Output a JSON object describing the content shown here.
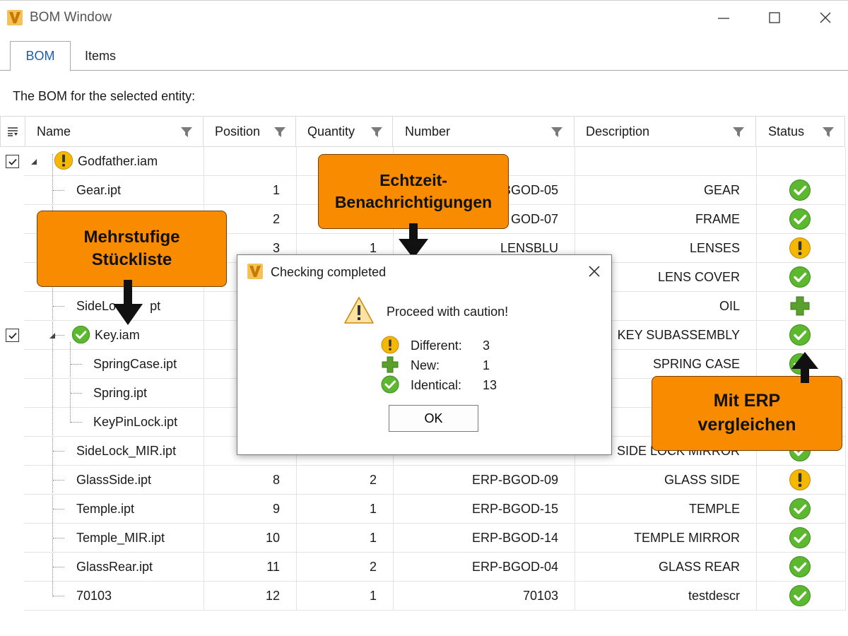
{
  "window": {
    "title": "BOM Window",
    "logo_letter": "V"
  },
  "tabs": [
    {
      "label": "BOM",
      "active": true
    },
    {
      "label": "Items",
      "active": false
    }
  ],
  "caption": "The BOM for the selected entity:",
  "grid": {
    "columns": [
      "Name",
      "Position",
      "Quantity",
      "Number",
      "Description",
      "Status"
    ],
    "rows": [
      {
        "name": "Godfather.iam",
        "position": "",
        "quantity": "",
        "number": "",
        "description": "",
        "status": "",
        "level": 0,
        "checked": true,
        "node_status": "different"
      },
      {
        "name": "Gear.ipt",
        "position": "1",
        "quantity": "",
        "number": "BGOD-05",
        "description": "GEAR",
        "status": "identical",
        "level": 1
      },
      {
        "name": "",
        "position": "2",
        "quantity": "",
        "number": "GOD-07",
        "description": "FRAME",
        "status": "identical",
        "level": 1
      },
      {
        "name": "",
        "position": "3",
        "quantity": "1",
        "number": "LENSBLU",
        "description": "LENSES",
        "status": "different",
        "level": 1
      },
      {
        "name": "",
        "position": "",
        "quantity": "",
        "number": "",
        "description": "LENS COVER",
        "status": "identical",
        "level": 1
      },
      {
        "name": "SideLo",
        "name_tail": "pt",
        "position": "",
        "quantity": "",
        "number": "",
        "description": "OIL",
        "status": "new",
        "level": 1
      },
      {
        "name": "Key.iam",
        "position": "",
        "quantity": "",
        "number": "",
        "description": "KEY SUBASSEMBLY",
        "status": "identical",
        "level": 1,
        "checked": true,
        "node_status": "identical"
      },
      {
        "name": "SpringCase.ipt",
        "position": "",
        "quantity": "",
        "number": "",
        "description": "SPRING CASE",
        "status": "identical",
        "level": 2
      },
      {
        "name": "Spring.ipt",
        "position": "",
        "quantity": "",
        "number": "",
        "description": "",
        "status": "",
        "level": 2
      },
      {
        "name": "KeyPinLock.ipt",
        "position": "",
        "quantity": "",
        "number": "",
        "description": "",
        "status": "",
        "level": 2
      },
      {
        "name": "SideLock_MIR.ipt",
        "position": "",
        "quantity": "",
        "number": "",
        "description": "SIDE LOCK MIRROR",
        "status": "identical",
        "level": 1
      },
      {
        "name": "GlassSide.ipt",
        "position": "8",
        "quantity": "2",
        "number": "ERP-BGOD-09",
        "description": "GLASS SIDE",
        "status": "different",
        "level": 1
      },
      {
        "name": "Temple.ipt",
        "position": "9",
        "quantity": "1",
        "number": "ERP-BGOD-15",
        "description": "TEMPLE",
        "status": "identical",
        "level": 1
      },
      {
        "name": "Temple_MIR.ipt",
        "position": "10",
        "quantity": "1",
        "number": "ERP-BGOD-14",
        "description": "TEMPLE MIRROR",
        "status": "identical",
        "level": 1
      },
      {
        "name": "GlassRear.ipt",
        "position": "11",
        "quantity": "2",
        "number": "ERP-BGOD-04",
        "description": "GLASS REAR",
        "status": "identical",
        "level": 1
      },
      {
        "name": "70103",
        "position": "12",
        "quantity": "1",
        "number": "70103",
        "description": "testdescr",
        "status": "identical",
        "level": 1
      }
    ]
  },
  "dialog": {
    "title": "Checking completed",
    "message": "Proceed with caution!",
    "stats": [
      {
        "label": "Different:",
        "value": "3",
        "icon": "warning-circle-icon"
      },
      {
        "label": "New:",
        "value": "1",
        "icon": "plus-icon"
      },
      {
        "label": "Identical:",
        "value": "13",
        "icon": "check-circle-icon"
      }
    ],
    "ok_label": "OK"
  },
  "callouts": {
    "realtime": "Echtzeit-\nBenachrichtigungen",
    "multilevel": "Mehrstufige\nStückliste",
    "erp": "Mit ERP\nvergleichen"
  },
  "colors": {
    "accent_orange": "#f88b00",
    "check_green": "#5cb82e",
    "warn_yellow": "#f5b800",
    "tab_blue": "#1c5fa8"
  }
}
